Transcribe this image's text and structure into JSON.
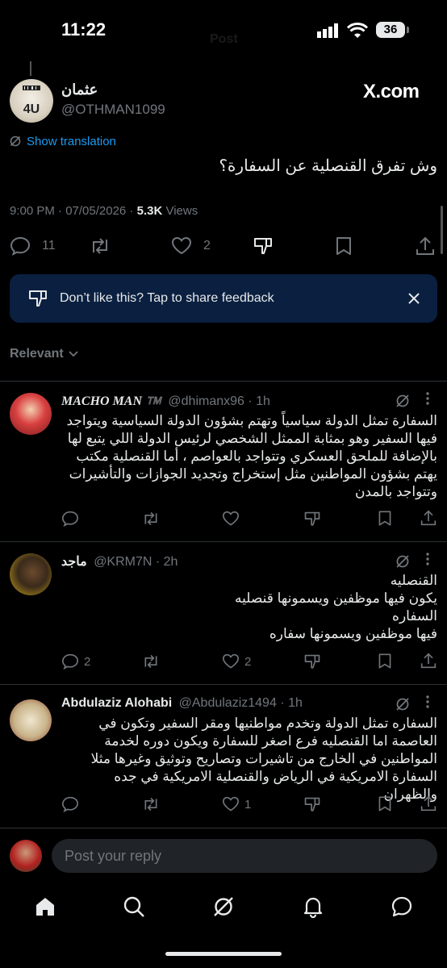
{
  "status_bar": {
    "time": "11:22",
    "battery": "36"
  },
  "header_bg_title": "Post",
  "post": {
    "author_name": "عثمان",
    "author_handle": "@OTHMAN1099",
    "source_badge": "X.com",
    "translate_label": "Show translation",
    "text": "وش تفرق القنصلية عن السفارة؟",
    "time": "9:00 PM · 07/05/2026 ·",
    "views_count": "5.3K",
    "views_label": "Views",
    "replies": "11",
    "likes": "2"
  },
  "feedback_banner": {
    "text": "Don’t like this? Tap to share feedback"
  },
  "sort": {
    "label": "Relevant"
  },
  "replies": [
    {
      "name": "MACHO MAN ™️",
      "handle": "@dhimanx96 · 1h",
      "text": "السفارة تمثل الدولة سياسياً وتهتم بشؤون الدولة السياسية ويتواجد فيها السفير وهو بمثابة الممثل الشخصي لرئيس الدولة اللي يتبع لها بالإضافة للملحق العسكري وتتواجد بالعواصم ، أما القنصلية مكتب يهتم بشؤون المواطنين مثل إستخراج وتجديد الجوازات والتأشيرات وتتواجد بالمدن",
      "replies": "",
      "likes": ""
    },
    {
      "name": "ماجد",
      "handle": "@KRM7N · 2h",
      "lines": [
        "القنصليه",
        "يكون فيها موظفين ويسمونها قنصليه",
        "السفاره",
        "فيها موظفين ويسمونها سفاره"
      ],
      "replies": "2",
      "likes": "2"
    },
    {
      "name": "Abdulaziz Alohabi",
      "handle": "@Abdulaziz1494 · 1h",
      "text": "السفاره تمثل الدولة وتخدم مواطنيها ومقر السفير وتكون في العاصمة اما القنصليه فرع اصغر للسفارة ويكون دوره لخدمة المواطنين في الخارج من تاشيرات وتصاريح وتوثيق وغيرها مثلا السفارة الامريكية في الرياض والقنصلية الامريكية في جده والظهران",
      "replies": "",
      "likes": "1"
    }
  ],
  "composer": {
    "placeholder": "Post your reply"
  },
  "colors": {
    "accent": "#1d9bf0",
    "banner_bg": "#0b2040",
    "divider": "#2f3336",
    "muted": "#71767b"
  },
  "bottom_nav": [
    "home-icon",
    "search-icon",
    "grok-icon",
    "notifications-icon",
    "messages-icon"
  ]
}
